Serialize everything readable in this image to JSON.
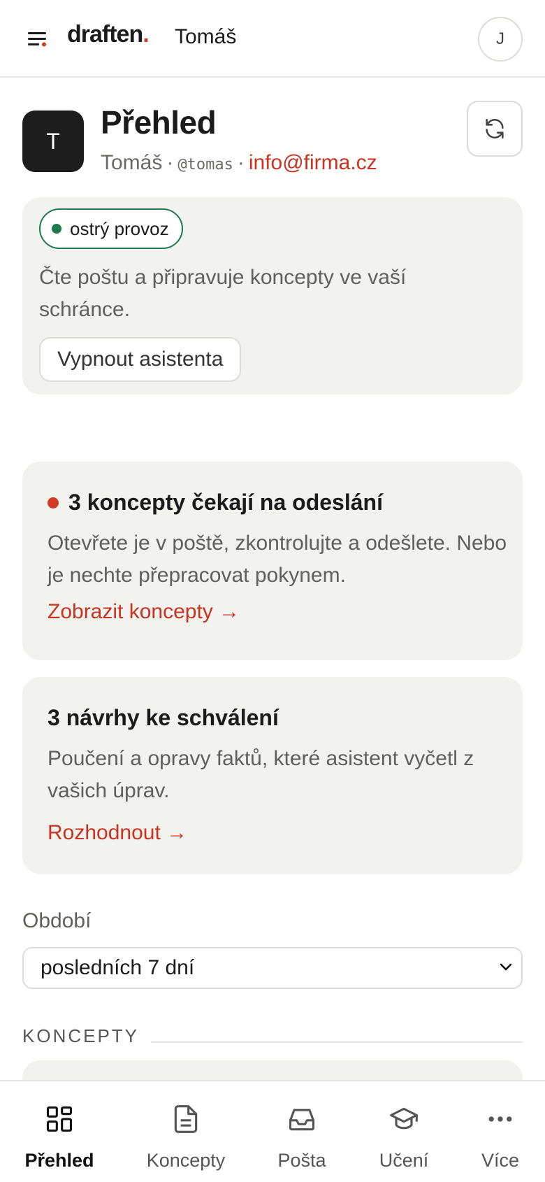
{
  "topbar": {
    "logo_text": "draften",
    "logo_dot": ".",
    "user_name": "Tomáš",
    "avatar_initial": "J"
  },
  "header": {
    "avatar_initial": "T",
    "title": "Přehled",
    "user_name": "Tomáš",
    "separator": "·",
    "handle": "@tomas",
    "email": "info@firma.cz"
  },
  "status": {
    "badge": "ostrý provoz",
    "description": "Čte poštu a připravuje koncepty ve vaší schránce.",
    "toggle_label": "Vypnout asistenta"
  },
  "drafts_card": {
    "title": "3 koncepty čekají na odeslání",
    "description": "Otevřete je v poště, zkontrolujte a odešlete. Nebo je nechte přepracovat pokynem.",
    "link": "Zobrazit koncepty →"
  },
  "proposals_card": {
    "title": "3 návrhy ke schválení",
    "description": "Poučení a opravy faktů, které asistent vyčetl z vašich úprav.",
    "link": "Rozhodnout →"
  },
  "period": {
    "label": "Období",
    "selected": "posledních 7 dní"
  },
  "section": {
    "title": "KONCEPTY"
  },
  "nav": {
    "items": [
      {
        "label": "Přehled",
        "icon": "grid-icon",
        "active": true
      },
      {
        "label": "Koncepty",
        "icon": "document-icon",
        "active": false
      },
      {
        "label": "Pošta",
        "icon": "inbox-icon",
        "active": false
      },
      {
        "label": "Učení",
        "icon": "graduation-cap-icon",
        "active": false
      },
      {
        "label": "Více",
        "icon": "more-dots-icon",
        "active": false
      }
    ]
  },
  "colors": {
    "accent_red": "#d13b24",
    "live_green": "#1f7a4d",
    "card_bg": "#f2f2ef"
  }
}
